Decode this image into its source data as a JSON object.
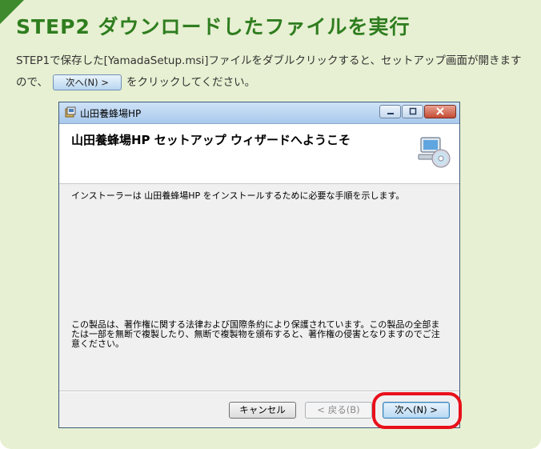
{
  "step": {
    "title": "STEP2 ダウンロードしたファイルを実行",
    "desc_part1": "STEP1で保存した[YamadaSetup.msi]ファイルをダブルクリックすると、セットアップ画面が開きますので、",
    "inline_button": "次へ(N) >",
    "desc_part2": "をクリックしてください。"
  },
  "dialog": {
    "window_title": "山田養蜂場HP",
    "header_title": "山田養蜂場HP セットアップ ウィザードへようこそ",
    "intro": "インストーラーは 山田養蜂場HP をインストールするために必要な手順を示します。",
    "copyright": "この製品は、著作権に関する法律および国際条約により保護されています。この製品の全部または一部を無断で複製したり、無断で複製物を頒布すると、著作権の侵害となりますのでご注意ください。",
    "buttons": {
      "cancel": "キャンセル",
      "back": "< 戻る(B)",
      "next": "次へ(N) >"
    }
  },
  "colors": {
    "panel": "#e7f0d2",
    "title": "#2f7d1f",
    "highlight": "#e8101b"
  }
}
